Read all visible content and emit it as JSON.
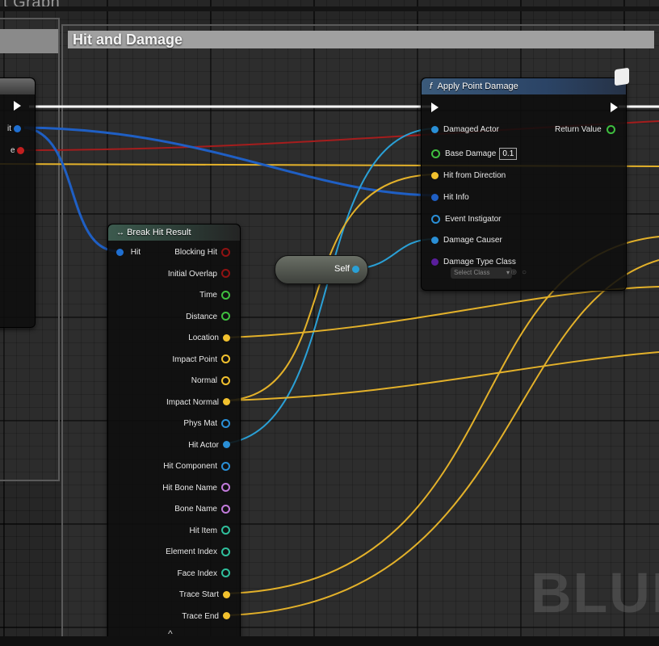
{
  "graph_title": "t Graph",
  "comment_title": "Hit and Damage",
  "watermark": "BLUE",
  "left_node": {
    "pins": [
      {
        "label": "it",
        "color": "#1f6fd1"
      },
      {
        "label": "e",
        "color": "#c21f1f"
      }
    ]
  },
  "break_hit_result": {
    "title": "Break Hit Result",
    "input_pin": "Hit",
    "outputs": [
      {
        "label": "Blocking Hit",
        "color": "#8f1212",
        "connected": false
      },
      {
        "label": "Initial Overlap",
        "color": "#8f1212",
        "connected": false
      },
      {
        "label": "Time",
        "color": "#3fbf3f",
        "connected": false
      },
      {
        "label": "Distance",
        "color": "#3fbf3f",
        "connected": false
      },
      {
        "label": "Location",
        "color": "#f2c12e",
        "connected": true
      },
      {
        "label": "Impact Point",
        "color": "#f2c12e",
        "connected": false
      },
      {
        "label": "Normal",
        "color": "#f2c12e",
        "connected": false
      },
      {
        "label": "Impact Normal",
        "color": "#f2c12e",
        "connected": true
      },
      {
        "label": "Phys Mat",
        "color": "#2a8fd6",
        "connected": false
      },
      {
        "label": "Hit Actor",
        "color": "#2a8fd6",
        "connected": true
      },
      {
        "label": "Hit Component",
        "color": "#2a8fd6",
        "connected": false
      },
      {
        "label": "Hit Bone Name",
        "color": "#c27bdb",
        "connected": false
      },
      {
        "label": "Bone Name",
        "color": "#c27bdb",
        "connected": false
      },
      {
        "label": "Hit Item",
        "color": "#2fbf9c",
        "connected": false
      },
      {
        "label": "Element Index",
        "color": "#2fbf9c",
        "connected": false
      },
      {
        "label": "Face Index",
        "color": "#2fbf9c",
        "connected": false
      },
      {
        "label": "Trace Start",
        "color": "#f2c12e",
        "connected": true
      },
      {
        "label": "Trace End",
        "color": "#f2c12e",
        "connected": true
      }
    ],
    "collapse_glyph": "^"
  },
  "self_node": {
    "label": "Self"
  },
  "apply_point_damage": {
    "title": "Apply Point Damage",
    "func_glyph": "f",
    "inputs": [
      {
        "label": "Damaged Actor",
        "color": "#2a8fd6",
        "connected": true
      },
      {
        "label": "Base Damage",
        "color": "#3fbf3f",
        "connected": false,
        "value": "0.1"
      },
      {
        "label": "Hit from Direction",
        "color": "#f2c12e",
        "connected": true
      },
      {
        "label": "Hit Info",
        "color": "#1f5fc4",
        "connected": true
      },
      {
        "label": "Event Instigator",
        "color": "#2a8fd6",
        "connected": false
      },
      {
        "label": "Damage Causer",
        "color": "#2a8fd6",
        "connected": true
      },
      {
        "label": "Damage Type Class",
        "color": "#5a1e9c",
        "connected": true
      }
    ],
    "select_placeholder": "Select Class",
    "output": {
      "label": "Return Value",
      "color": "#3fbf3f"
    }
  },
  "wire_colors": {
    "exec": "#ffffff",
    "hit_struct": "#1f5fc4",
    "object": "#2aa0d6",
    "vector": "#f2c12e",
    "bool": "#8f1212"
  }
}
